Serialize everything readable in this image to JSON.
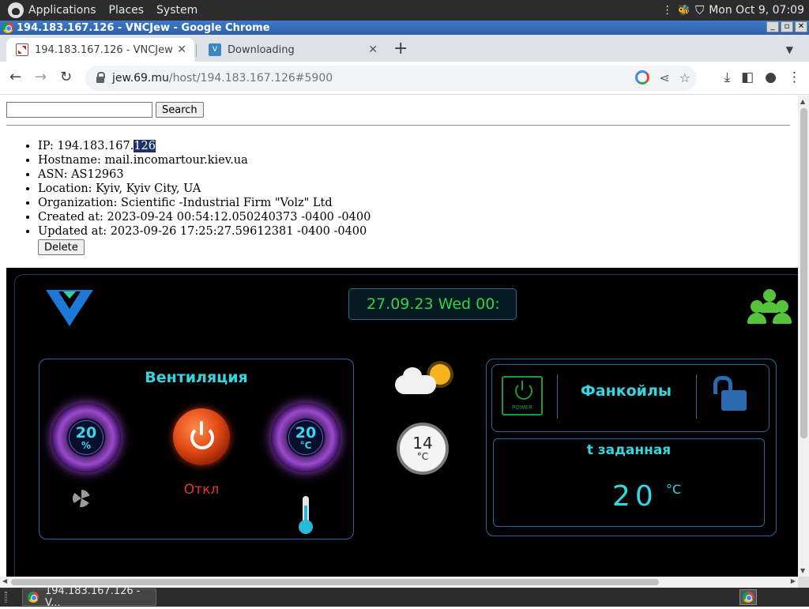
{
  "panel": {
    "menus": [
      "Applications",
      "Places",
      "System"
    ],
    "clock": "Mon Oct  9, 07:09"
  },
  "window": {
    "title": "194.183.167.126 - VNCJew - Google Chrome"
  },
  "tabs": [
    {
      "label": "194.183.167.126 - VNCJew",
      "active": true
    },
    {
      "label": "Downloading",
      "active": false
    }
  ],
  "address": {
    "domain": "jew.69.mu",
    "path": "/host/194.183.167.126#5900"
  },
  "search": {
    "value": "",
    "button": "Search"
  },
  "host": {
    "ip_label": "IP: ",
    "ip_prefix": "194.183.167.",
    "ip_selected": "126",
    "hostname": "Hostname: mail.incomartour.kiev.ua",
    "asn": "ASN: AS12963",
    "location": "Location: Kyiv, Kyiv City, UA",
    "organization": "Organization: Scientific -Industrial Firm \"Volz\" Ltd",
    "created": "Created at: 2023-09-24 00:54:12.050240373 -0400 -0400",
    "updated": "Updated at: 2023-09-26 17:25:27.59612381 -0400 -0400",
    "delete_button": "Delete"
  },
  "hmi": {
    "datetime": "27.09.23 Wed 00:",
    "ventilation": {
      "title": "Вентиляция",
      "fan_speed": "20",
      "fan_unit": "%",
      "temperature": "20",
      "temperature_unit": "°C",
      "status": "Откл"
    },
    "outdoor_temp": "14",
    "outdoor_unit": "°C",
    "fancoils": {
      "title": "Фанкойлы",
      "power_label": "POWER",
      "setpoint_title": "t заданная",
      "setpoint_value": "20",
      "setpoint_unit": "°C"
    }
  },
  "taskbar": {
    "item": "194.183.167.126 - V..."
  },
  "colors": {
    "accent_cyan": "#34d6e0",
    "status_red": "#e23a2c",
    "clock_green": "#32d24a",
    "selection": "#1f2f6a"
  }
}
